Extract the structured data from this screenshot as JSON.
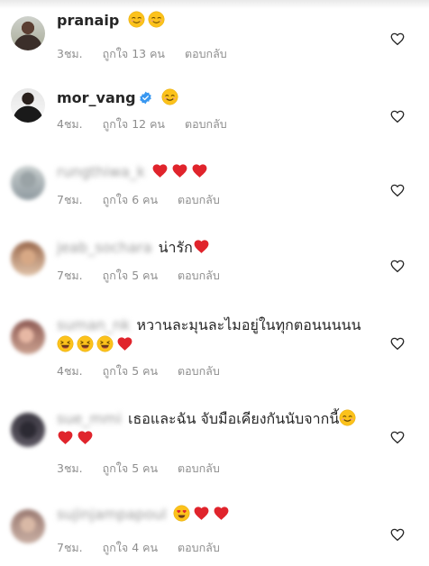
{
  "comments": [
    {
      "username": "pranaip",
      "blurred": false,
      "verified": false,
      "text": "",
      "text2": "",
      "emoji": [
        "relieved",
        "relieved"
      ],
      "emoji2": [],
      "time": "3ชม.",
      "likes": "ถูกใจ 13 คน",
      "reply": "ตอบกลับ"
    },
    {
      "username": "mor_vang",
      "blurred": false,
      "verified": true,
      "text": "",
      "text2": "",
      "emoji": [
        "smile"
      ],
      "emoji2": [],
      "time": "4ชม.",
      "likes": "ถูกใจ 12 คน",
      "reply": "ตอบกลับ"
    },
    {
      "username": "rungthiwa_k",
      "blurred": true,
      "verified": false,
      "text": "",
      "text2": "",
      "emoji": [
        "heart",
        "heart",
        "heart"
      ],
      "emoji2": [],
      "time": "7ชม.",
      "likes": "ถูกใจ 6 คน",
      "reply": "ตอบกลับ"
    },
    {
      "username": "jeab_sochara",
      "blurred": true,
      "verified": false,
      "text": "น่ารัก",
      "text2": "",
      "emoji": [
        "heart"
      ],
      "emoji2": [],
      "time": "7ชม.",
      "likes": "ถูกใจ 5 คน",
      "reply": "ตอบกลับ"
    },
    {
      "username": "suman_nk",
      "blurred": true,
      "verified": false,
      "text": "หวานละมุนละไมอยู่ในทุกตอนนนนน",
      "text2": "",
      "emoji": [],
      "emoji2": [
        "laugh",
        "laugh",
        "laugh",
        "heart"
      ],
      "time": "4ชม.",
      "likes": "ถูกใจ 5 คน",
      "reply": "ตอบกลับ"
    },
    {
      "username": "sue_mmi",
      "blurred": true,
      "verified": false,
      "text": "เธอและฉัน จับมือเคียงกันนับจากนี้",
      "text2": "",
      "emoji": [
        "smile"
      ],
      "emoji2": [
        "heart",
        "heart"
      ],
      "time": "3ชม.",
      "likes": "ถูกใจ 5 คน",
      "reply": "ตอบกลับ"
    },
    {
      "username": "sujinjampapoul",
      "blurred": true,
      "verified": false,
      "text": "",
      "text2": "",
      "emoji": [
        "hearteyes",
        "heart",
        "heart"
      ],
      "emoji2": [],
      "time": "7ชม.",
      "likes": "ถูกใจ 4 คน",
      "reply": "ตอบกลับ"
    }
  ],
  "colors": {
    "heart": "#e0242c",
    "emoji_yellow": "#fcc21b",
    "verified_blue": "#3897f0",
    "meta": "#8e8e8e"
  },
  "icons": {
    "like": "heart-outline-icon",
    "verified": "verified-badge-icon"
  }
}
